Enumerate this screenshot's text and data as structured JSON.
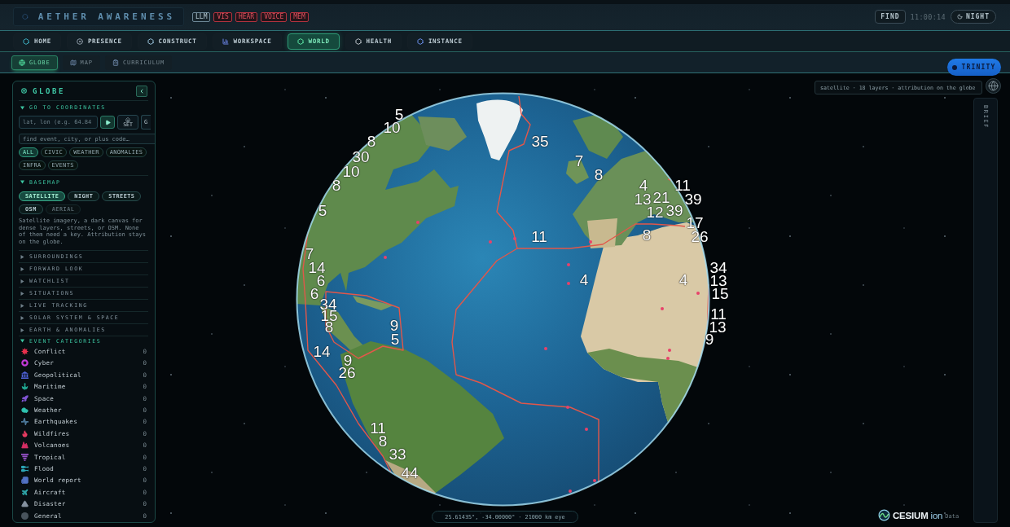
{
  "header": {
    "title": "AETHER AWARENESS",
    "badges": [
      {
        "label": "LLM",
        "on": true
      },
      {
        "label": "VIS",
        "on": false
      },
      {
        "label": "HEAR",
        "on": false
      },
      {
        "label": "VOICE",
        "on": false
      },
      {
        "label": "MEM",
        "on": false
      }
    ],
    "find_button": "FIND",
    "clock": "11:00:14",
    "theme_button": "NIGHT"
  },
  "nav_tabs": [
    {
      "label": "HOME",
      "selected": false
    },
    {
      "label": "PRESENCE",
      "selected": false
    },
    {
      "label": "CONSTRUCT",
      "selected": false
    },
    {
      "label": "WORKSPACE",
      "selected": false
    },
    {
      "label": "WORLD",
      "selected": true
    },
    {
      "label": "HEALTH",
      "selected": false
    },
    {
      "label": "INSTANCE",
      "selected": false
    }
  ],
  "sub_tabs": [
    {
      "label": "GLOBE",
      "selected": true
    },
    {
      "label": "MAP",
      "selected": false
    },
    {
      "label": "CURRICULUM",
      "selected": false
    }
  ],
  "assistant_button": "TRINITY",
  "panel": {
    "title": "GLOBE",
    "coordinates": {
      "heading": "GO TO COORDINATES",
      "expanded": true,
      "placeholder": "lat, lon (e.g. 64.84",
      "set_button": "SET",
      "extra_button": "G",
      "search_placeholder": "find event, city, or plus code…",
      "filters": [
        {
          "label": "ALL",
          "selected": true
        },
        {
          "label": "CIVIC",
          "selected": false
        },
        {
          "label": "WEATHER",
          "selected": false
        },
        {
          "label": "ANOMALIES",
          "selected": false
        },
        {
          "label": "INFRA",
          "selected": false
        },
        {
          "label": "EVENTS",
          "selected": false
        }
      ]
    },
    "basemap": {
      "heading": "BASEMAP",
      "expanded": true,
      "options": [
        {
          "label": "SATELLITE",
          "selected": true,
          "disabled": false
        },
        {
          "label": "NIGHT",
          "selected": false,
          "disabled": false
        },
        {
          "label": "STREETS",
          "selected": false,
          "disabled": false
        },
        {
          "label": "OSM",
          "selected": false,
          "disabled": false
        },
        {
          "label": "AERIAL",
          "selected": false,
          "disabled": true
        }
      ],
      "note": "Satellite imagery, a dark canvas for dense layers, streets, or OSM. None of them need a key. Attribution stays on the globe."
    },
    "sections": [
      {
        "heading": "SURROUNDINGS",
        "expanded": false
      },
      {
        "heading": "FORWARD LOOK",
        "expanded": false
      },
      {
        "heading": "WATCHLIST",
        "expanded": false
      },
      {
        "heading": "SITUATIONS",
        "expanded": false
      },
      {
        "heading": "LIVE TRACKING",
        "expanded": false
      },
      {
        "heading": "SOLAR SYSTEM & SPACE",
        "expanded": false
      },
      {
        "heading": "EARTH & ANOMALIES",
        "expanded": false
      }
    ],
    "categories": {
      "heading": "EVENT CATEGORIES",
      "expanded": true,
      "items": [
        {
          "name": "Conflict",
          "count": "0",
          "color": "#e8304c"
        },
        {
          "name": "Cyber",
          "count": "0",
          "color": "#c23ad6"
        },
        {
          "name": "Geopolitical",
          "count": "0",
          "color": "#4f62d8"
        },
        {
          "name": "Maritime",
          "count": "0",
          "color": "#1fa58f"
        },
        {
          "name": "Space",
          "count": "0",
          "color": "#8256d6"
        },
        {
          "name": "Weather",
          "count": "0",
          "color": "#2fc2b0"
        },
        {
          "name": "Earthquakes",
          "count": "0",
          "color": "#4a7596"
        },
        {
          "name": "Wildfires",
          "count": "0",
          "color": "#e63c62"
        },
        {
          "name": "Volcanoes",
          "count": "0",
          "color": "#d42e64"
        },
        {
          "name": "Tropical",
          "count": "0",
          "color": "#9550c6"
        },
        {
          "name": "Flood",
          "count": "0",
          "color": "#2ca6b6"
        },
        {
          "name": "World report",
          "count": "0",
          "color": "#5272c4"
        },
        {
          "name": "Aircraft",
          "count": "0",
          "color": "#2fa3a6"
        },
        {
          "name": "Disaster",
          "count": "0",
          "color": "#8592a0"
        },
        {
          "name": "General",
          "count": "0",
          "color": "#48535c"
        }
      ]
    }
  },
  "globe": {
    "cluster_labels": [
      "5",
      "10",
      "8",
      "35",
      "30",
      "7",
      "10",
      "8",
      "8",
      "4",
      "11",
      "13",
      "21",
      "39",
      "5",
      "12",
      "39",
      "17",
      "11",
      "8",
      "26",
      "7",
      "14",
      "34",
      "6",
      "4",
      "4",
      "13",
      "6",
      "15",
      "34",
      "15",
      "11",
      "8",
      "9",
      "13",
      "5",
      "9",
      "14",
      "9",
      "26",
      "11",
      "8",
      "33",
      "44"
    ],
    "layer_info": "satellite · 18 layers · attribution on the globe",
    "camera_readout": "25.61435°, -34.00000° · 21000 km eye"
  },
  "side_panel": {
    "label": "BRIEF"
  },
  "attribution": {
    "logo": "**CESIUM** ion",
    "link": "Data"
  }
}
